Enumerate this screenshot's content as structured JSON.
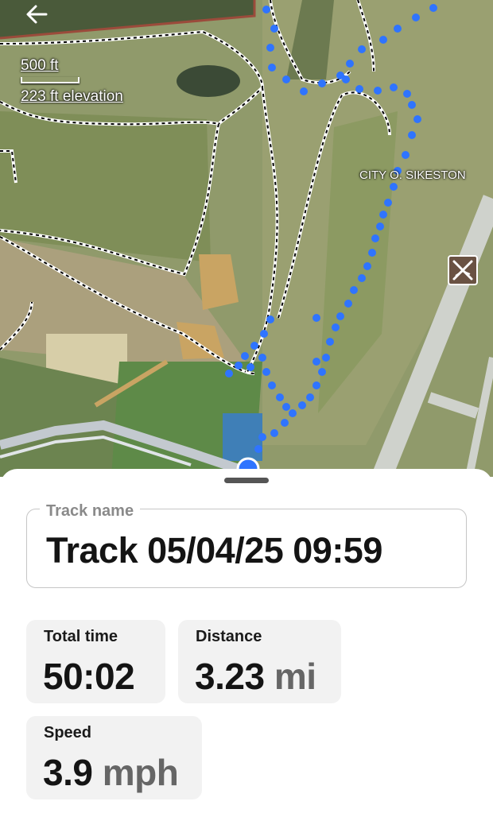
{
  "map": {
    "scale_distance": "500 ft",
    "elevation": "223 ft elevation",
    "place_label": "CITY O. SIKESTON",
    "airport_icon": "airport-icon",
    "track_color": "#2f74ff"
  },
  "sheet": {
    "track_name_label": "Track name",
    "track_name_value": "Track 05/04/25 09:59",
    "stats": {
      "total_time_label": "Total time",
      "total_time_value": "50:02",
      "distance_label": "Distance",
      "distance_value": "3.23",
      "distance_unit": "mi",
      "speed_label": "Speed",
      "speed_value": "3.9",
      "speed_unit": "mph"
    }
  }
}
